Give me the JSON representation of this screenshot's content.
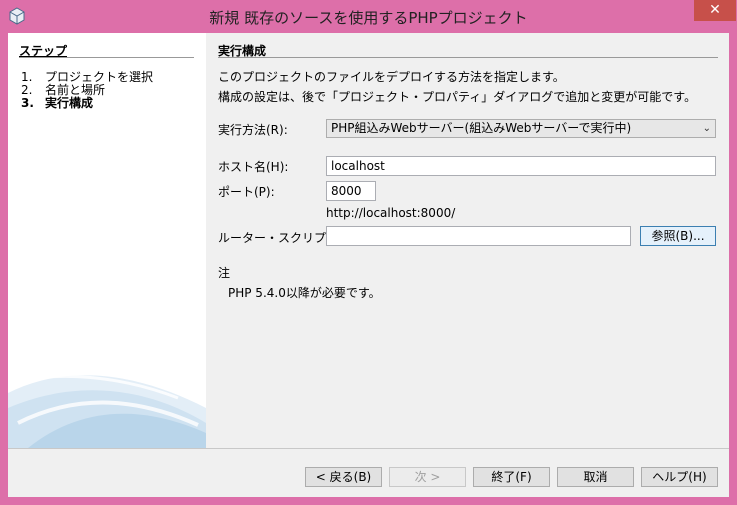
{
  "window": {
    "title": "新規 既存のソースを使用するPHPプロジェクト",
    "close_glyph": "✕"
  },
  "steps": {
    "title": "ステップ",
    "items": [
      {
        "num": "1.",
        "label": "プロジェクトを選択"
      },
      {
        "num": "2.",
        "label": "名前と場所"
      },
      {
        "num": "3.",
        "label": "実行構成"
      }
    ]
  },
  "panel": {
    "title": "実行構成",
    "desc1": "このプロジェクトのファイルをデプロイする方法を指定します。",
    "desc2": "構成の設定は、後で「プロジェクト・プロパティ」ダイアログで追加と変更が可能です。",
    "run_as_label": "実行方法(R):",
    "run_as_value": "PHP組込みWebサーバー(組込みWebサーバーで実行中)",
    "host_label": "ホスト名(H):",
    "host_value": "localhost",
    "port_label": "ポート(P):",
    "port_value": "8000",
    "url": "http://localhost:8000/",
    "router_label": "ルーター・スクリプト(R):",
    "router_value": "",
    "browse_label": "参照(B)...",
    "note_heading": "注",
    "note_text": "PHP 5.4.0以降が必要です。"
  },
  "buttons": {
    "back": "< 戻る(B)",
    "next": "次 >",
    "finish": "終了(F)",
    "cancel": "取消",
    "help": "ヘルプ(H)"
  },
  "colors": {
    "frame": "#dd6fa9",
    "close": "#c7504a",
    "panel": "#f0f0f0"
  }
}
